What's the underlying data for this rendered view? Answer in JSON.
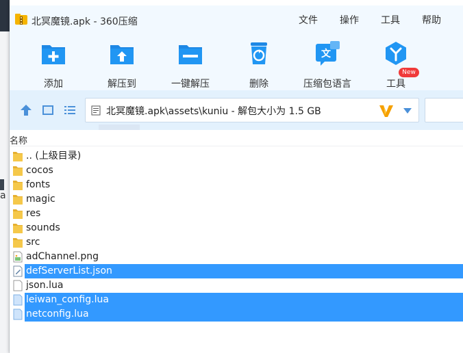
{
  "window": {
    "title": "北冥魔镜.apk - 360压缩"
  },
  "menu": {
    "items": [
      "文件",
      "操作",
      "工具",
      "帮助"
    ]
  },
  "toolbar": {
    "buttons": [
      {
        "label": "添加",
        "icon": "add-icon"
      },
      {
        "label": "解压到",
        "icon": "extract-to-icon"
      },
      {
        "label": "一键解压",
        "icon": "one-click-extract-icon"
      },
      {
        "label": "删除",
        "icon": "recycle-bin-icon"
      },
      {
        "label": "压缩包语言",
        "icon": "archive-language-icon"
      },
      {
        "label": "工具",
        "icon": "tools-icon"
      }
    ],
    "new_badge": "New"
  },
  "address": {
    "path": "北冥魔镜.apk\\assets\\kuniu - 解包大小为 1.5 GB"
  },
  "list": {
    "column_name": "名称",
    "rows": [
      {
        "name": ".. (上级目录)",
        "type": "folder",
        "selected": false
      },
      {
        "name": "cocos",
        "type": "folder",
        "selected": false
      },
      {
        "name": "fonts",
        "type": "folder",
        "selected": false
      },
      {
        "name": "magic",
        "type": "folder",
        "selected": false
      },
      {
        "name": "res",
        "type": "folder",
        "selected": false
      },
      {
        "name": "sounds",
        "type": "folder",
        "selected": false
      },
      {
        "name": "src",
        "type": "folder",
        "selected": false
      },
      {
        "name": "adChannel.png",
        "type": "image",
        "selected": false
      },
      {
        "name": "defServerList.json",
        "type": "json",
        "selected": true
      },
      {
        "name": "json.lua",
        "type": "file",
        "selected": false
      },
      {
        "name": "leiwan_config.lua",
        "type": "file",
        "selected": true
      },
      {
        "name": "netconfig.lua",
        "type": "file",
        "selected": true
      }
    ]
  },
  "background_window": {
    "visible_char": "a"
  },
  "colors": {
    "accent": "#3399ff",
    "toolbar_bg": "#f2f9ff",
    "address_bg": "#e3f1fd",
    "icon_blue": "#1e88e5",
    "folder_yellow": "#f0c040"
  }
}
